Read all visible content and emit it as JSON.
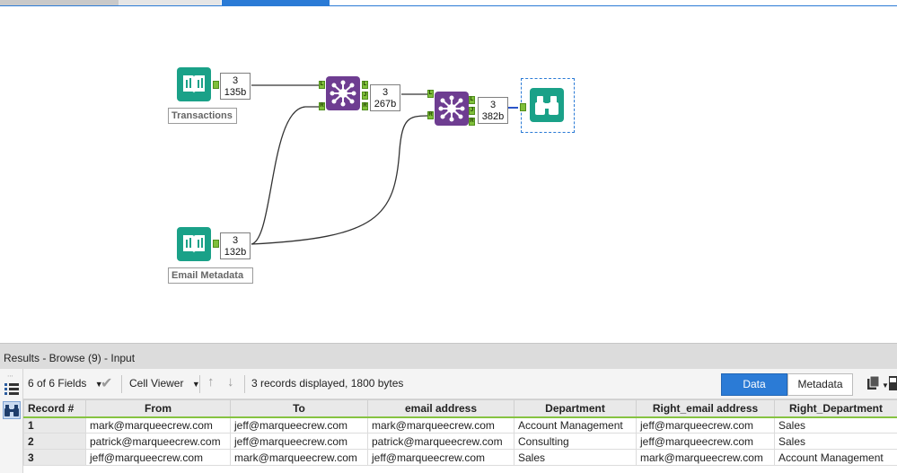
{
  "workflow": {
    "tools": {
      "transactions": {
        "label": "Transactions",
        "records": "3",
        "size": "135b"
      },
      "email_metadata": {
        "label": "Email Metadata",
        "records": "3",
        "size": "132b"
      },
      "join1": {
        "records": "3",
        "size": "267b"
      },
      "join2": {
        "records": "3",
        "size": "382b"
      }
    },
    "anchors": {
      "left": "L",
      "join": "J",
      "right": "R"
    }
  },
  "results": {
    "title": "Results - Browse (9) - Input",
    "fields_selector": "6 of 6 Fields",
    "viewer": "Cell Viewer",
    "status": "3 records displayed, 1800 bytes",
    "data_tab": "Data",
    "metadata_tab": "Metadata",
    "columns": [
      "Record #",
      "From",
      "To",
      "email address",
      "Department",
      "Right_email address",
      "Right_Department"
    ],
    "rows": [
      [
        "1",
        "mark@marqueecrew.com",
        "jeff@marqueecrew.com",
        "mark@marqueecrew.com",
        "Account Management",
        "jeff@marqueecrew.com",
        "Sales"
      ],
      [
        "2",
        "patrick@marqueecrew.com",
        "jeff@marqueecrew.com",
        "patrick@marqueecrew.com",
        "Consulting",
        "jeff@marqueecrew.com",
        "Sales"
      ],
      [
        "3",
        "jeff@marqueecrew.com",
        "mark@marqueecrew.com",
        "jeff@marqueecrew.com",
        "Sales",
        "mark@marqueecrew.com",
        "Account Management"
      ]
    ]
  },
  "colors": {
    "accent": "#2b7bd6",
    "input_tool": "#1aa188",
    "join_tool": "#6e3d91",
    "anchor": "#7fbf3a"
  }
}
